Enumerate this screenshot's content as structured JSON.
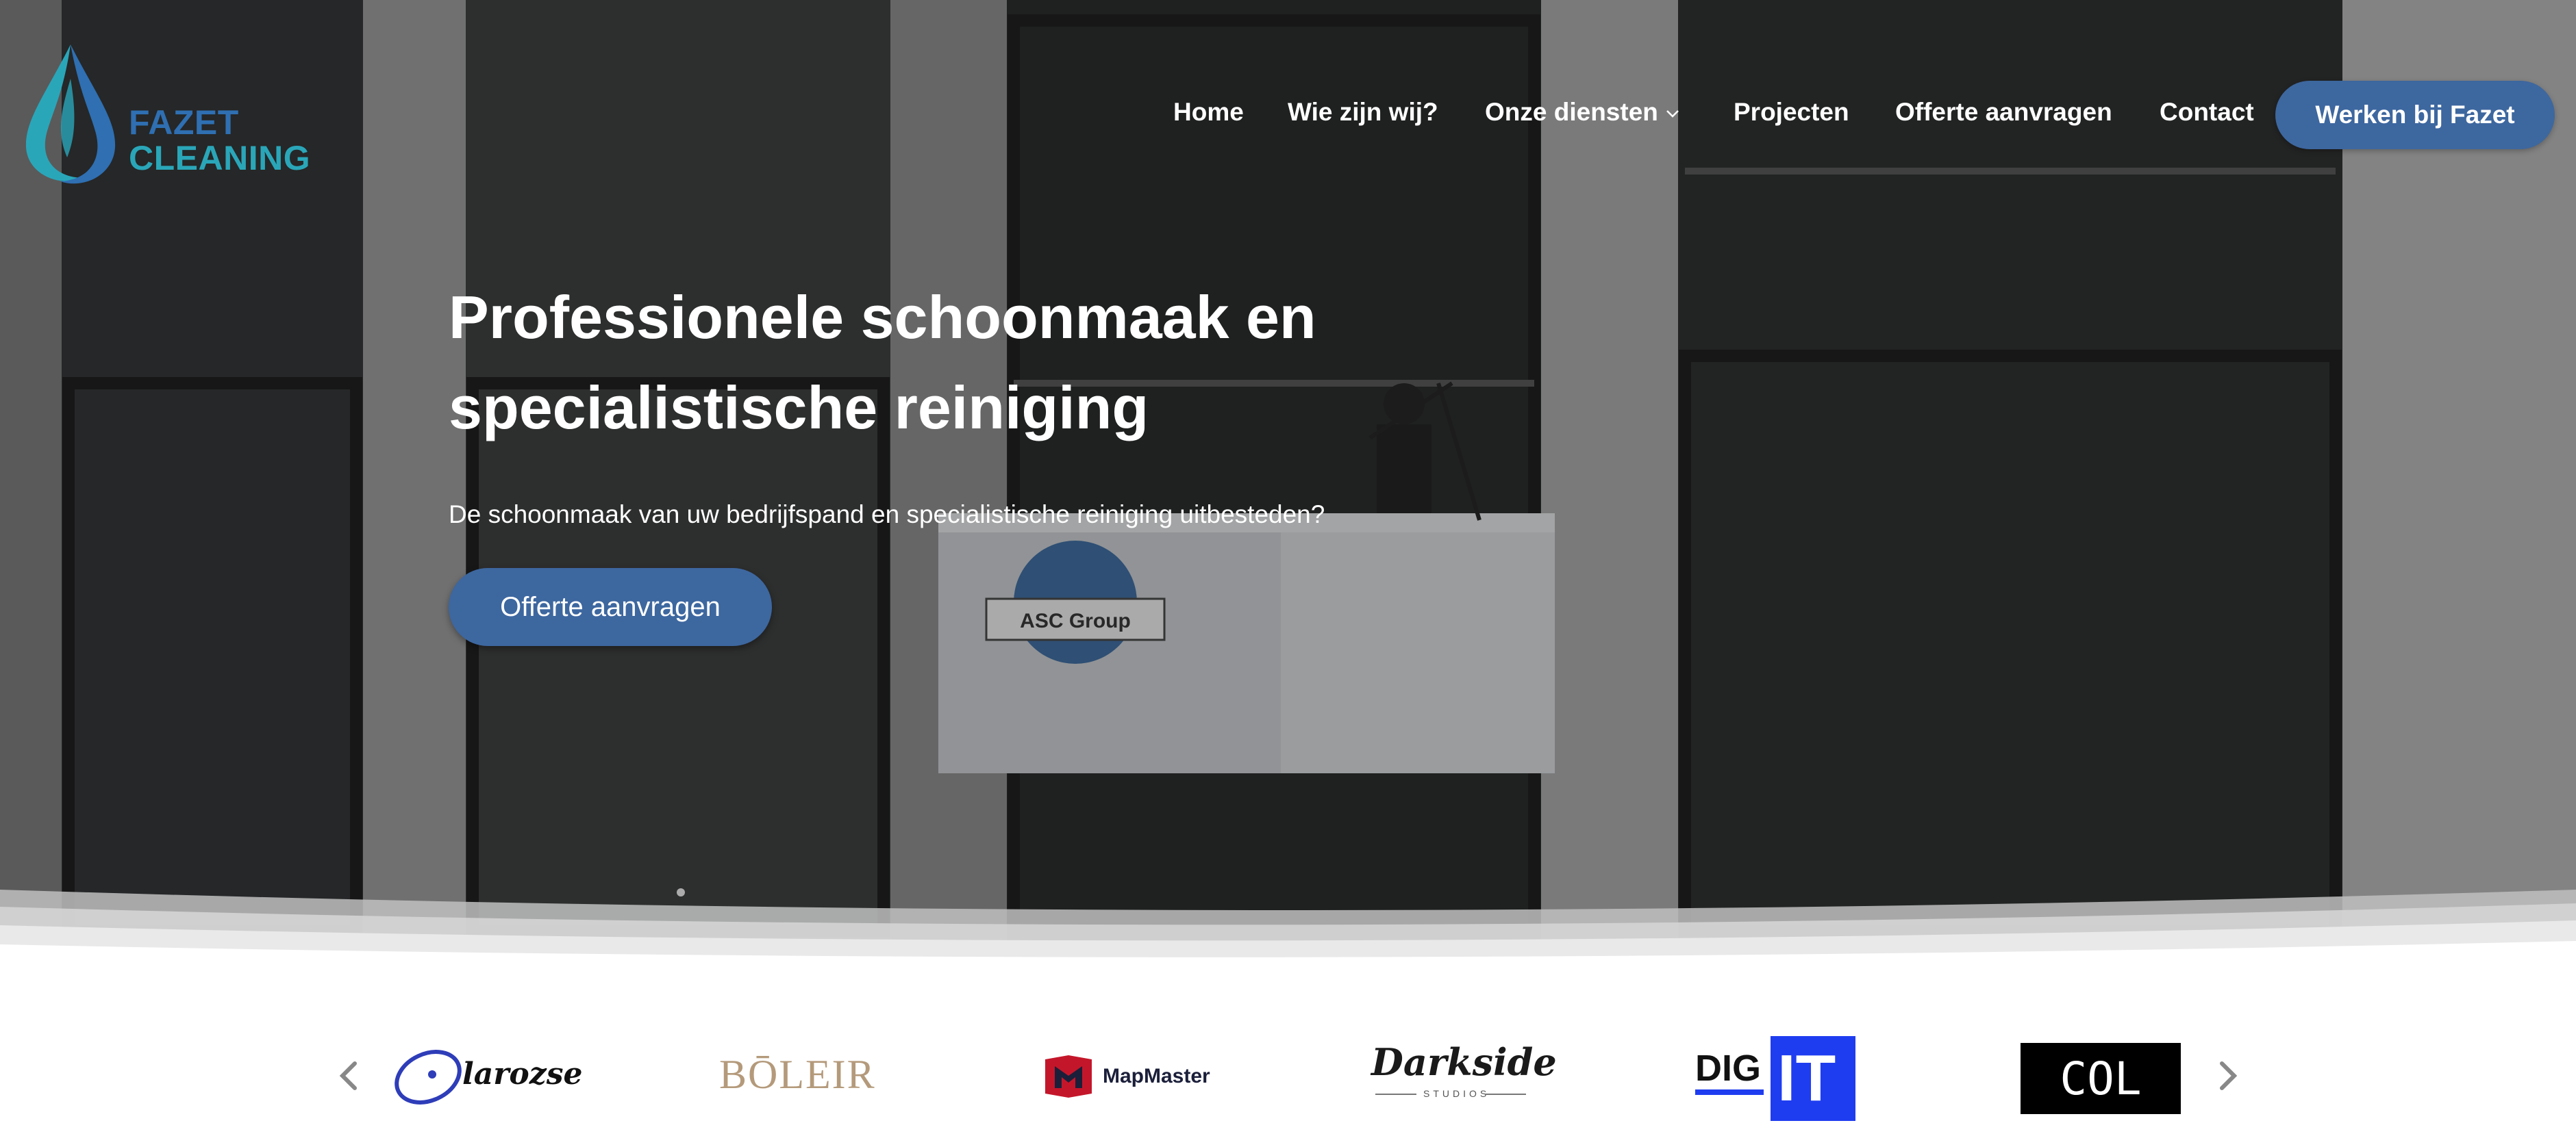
{
  "brand": {
    "line1": "FAZET",
    "line2": "CLEANING"
  },
  "nav": {
    "items": [
      {
        "label": "Home"
      },
      {
        "label": "Wie zijn wij?"
      },
      {
        "label": "Onze diensten"
      },
      {
        "label": "Projecten"
      },
      {
        "label": "Offerte aanvragen"
      },
      {
        "label": "Contact"
      }
    ],
    "cta": "Werken bij Fazet"
  },
  "hero": {
    "title_line1": "Professionele schoonmaak en",
    "title_line2": "specialistische reiniging",
    "subtitle": "De schoonmaak van uw bedrijfspand en specialistische reiniging uitbesteden?",
    "button": "Offerte aanvragen",
    "background_text": "ASC Group"
  },
  "partners": {
    "logos": [
      {
        "name": "larozse"
      },
      {
        "name": "BŌLEIR"
      },
      {
        "name": "MapMaster"
      },
      {
        "name": "Darkside",
        "tagline": "STUDIOS"
      },
      {
        "name": "DIG",
        "suffix": "IT"
      },
      {
        "name": "COL"
      }
    ]
  },
  "colors": {
    "accent": "#3d679f",
    "logo_blue": "#2f6fb2",
    "logo_teal": "#2aa6b9",
    "white": "#ffffff"
  },
  "icons": [
    "droplet-logo-icon",
    "chevron-down-icon",
    "chevron-left-icon",
    "chevron-right-icon"
  ]
}
